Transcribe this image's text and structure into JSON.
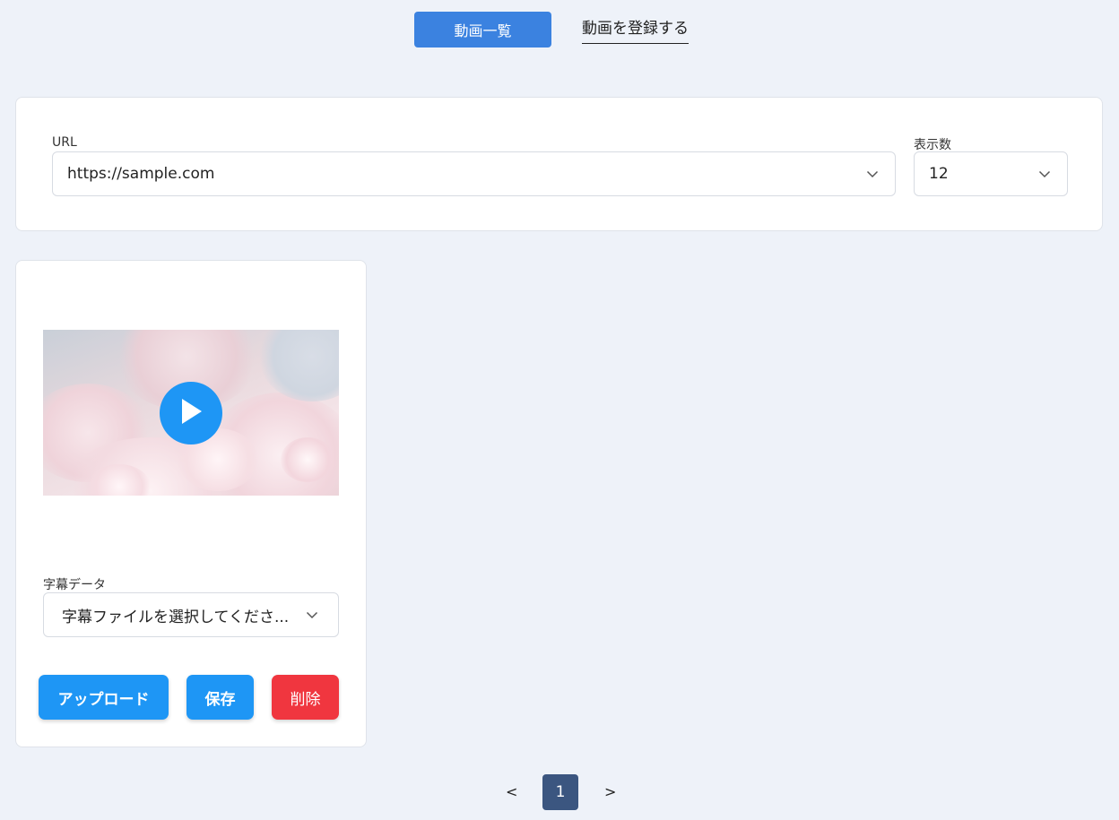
{
  "nav": {
    "list_label": "動画一覧",
    "register_label": "動画を登録する"
  },
  "filter": {
    "url_label": "URL",
    "url_value": "https://sample.com",
    "count_label": "表示数",
    "count_value": "12"
  },
  "video_card": {
    "subtitle_label": "字幕データ",
    "subtitle_select_value": "字幕ファイルを選択してくださ...",
    "upload_label": "アップロード",
    "save_label": "保存",
    "delete_label": "削除"
  },
  "pagination": {
    "prev": "<",
    "current": "1",
    "next": ">"
  },
  "colors": {
    "accent": "#3b82e0",
    "primary_button": "#1e96f5",
    "danger_button": "#f0363f",
    "page_active": "#3b5680",
    "background": "#eef2f9"
  },
  "icons": {
    "play": "play-icon",
    "dropdown": "chevron-down-icon"
  }
}
